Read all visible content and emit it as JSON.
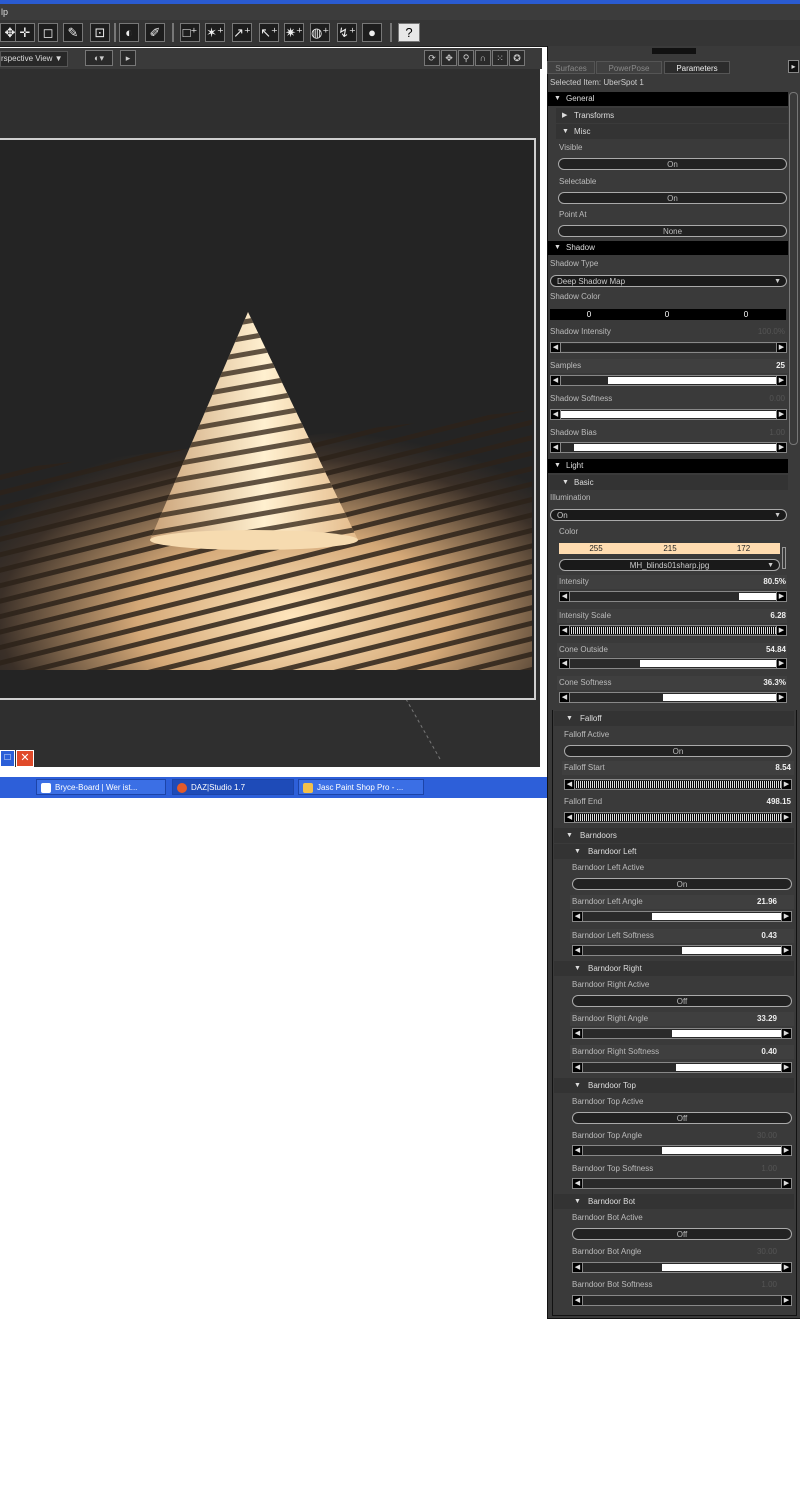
{
  "menubar": {
    "text": "lp"
  },
  "toolbar": {
    "buttons": [
      "✥",
      "✛",
      "◻",
      "✎",
      "⊡",
      "◐",
      "✐",
      "□⁺",
      "✶⁺",
      "↗⁺",
      "↖⁺",
      "✷⁺",
      "◍⁺",
      "↯⁺",
      "●",
      "?"
    ]
  },
  "viewport": {
    "view_label": "rspective View ▼",
    "render_colors": {
      "light": "#ffe0b0",
      "shadow": "#2a2a2a",
      "bg": "#242424"
    }
  },
  "taskbar": {
    "items": [
      {
        "label": "Bryce-Board | Wer ist...",
        "icon": "document-icon"
      },
      {
        "label": "DAZ|Studio 1.7",
        "icon": "daz-icon"
      },
      {
        "label": "Jasc Paint Shop Pro - ...",
        "icon": "paint-icon"
      }
    ]
  },
  "panel": {
    "tabs": [
      "Surfaces",
      "PowerPose",
      "Parameters"
    ],
    "active_tab": "Parameters",
    "selected_item": "Selected Item: UberSpot 1",
    "general": {
      "title": "General",
      "transforms": "Transforms",
      "misc": "Misc",
      "visible_label": "Visible",
      "visible_value": "On",
      "selectable_label": "Selectable",
      "selectable_value": "On",
      "point_at_label": "Point At",
      "point_at_value": "None"
    },
    "shadow": {
      "title": "Shadow",
      "type_label": "Shadow Type",
      "type_value": "Deep Shadow Map",
      "color_label": "Shadow Color",
      "color_r": "0",
      "color_g": "0",
      "color_b": "0",
      "intensity_label": "Shadow Intensity",
      "intensity_value": "100.0%",
      "samples_label": "Samples",
      "samples_value": "25",
      "softness_label": "Shadow Softness",
      "softness_value": "0.00",
      "bias_label": "Shadow Bias",
      "bias_value": "1.00"
    },
    "light": {
      "title": "Light",
      "basic": "Basic",
      "illumination_label": "Illumination",
      "illumination_value": "On",
      "color_label": "Color",
      "color_r": "255",
      "color_g": "215",
      "color_b": "172",
      "color_swatch": "#ffdcb0",
      "map_value": "MH_blinds01sharp.jpg",
      "intensity_label": "Intensity",
      "intensity_value": "80.5%",
      "intensity_scale_label": "Intensity Scale",
      "intensity_scale_value": "6.28",
      "cone_outside_label": "Cone Outside",
      "cone_outside_value": "54.84",
      "cone_softness_label": "Cone Softness",
      "cone_softness_value": "36.3%"
    },
    "falloff": {
      "title": "Falloff",
      "active_label": "Falloff Active",
      "active_value": "On",
      "start_label": "Falloff Start",
      "start_value": "8.54",
      "end_label": "Falloff End",
      "end_value": "498.15"
    },
    "barndoors": {
      "title": "Barndoors",
      "left": {
        "title": "Barndoor Left",
        "active_label": "Barndoor Left Active",
        "active_value": "On",
        "angle_label": "Barndoor Left Angle",
        "angle_value": "21.96",
        "softness_label": "Barndoor Left Softness",
        "softness_value": "0.43"
      },
      "right": {
        "title": "Barndoor Right",
        "active_label": "Barndoor Right Active",
        "active_value": "Off",
        "angle_label": "Barndoor Right Angle",
        "angle_value": "33.29",
        "softness_label": "Barndoor Right Softness",
        "softness_value": "0.40"
      },
      "top": {
        "title": "Barndoor Top",
        "active_label": "Barndoor Top Active",
        "active_value": "Off",
        "angle_label": "Barndoor Top Angle",
        "angle_value": "30.00",
        "softness_label": "Barndoor Top Softness",
        "softness_value": "1.00"
      },
      "bot": {
        "title": "Barndoor Bot",
        "active_label": "Barndoor Bot Active",
        "active_value": "Off",
        "angle_label": "Barndoor Bot Angle",
        "angle_value": "30.00",
        "softness_label": "Barndoor Bot Softness",
        "softness_value": "1.00"
      }
    },
    "slider_levels": {
      "shadow_intensity": 1.0,
      "samples": 0.78,
      "shadow_softness": 1.0,
      "shadow_bias": 0.94,
      "intensity": 0.18,
      "intensity_scale": 1.0,
      "cone_outside": 0.66,
      "cone_softness": 0.55,
      "falloff_start": 1.0,
      "falloff_end": 1.0,
      "bd_left_angle": 0.65,
      "bd_left_softness": 0.5,
      "bd_right_angle": 0.55,
      "bd_right_softness": 0.53,
      "bd_top_angle": 0.6,
      "bd_top_softness": 0.0,
      "bd_bot_angle": 0.6,
      "bd_bot_softness": 0.0
    }
  }
}
